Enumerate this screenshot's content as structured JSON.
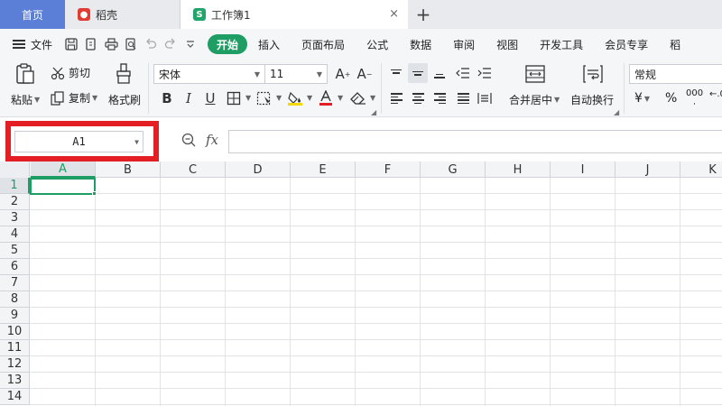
{
  "tabs": {
    "home": "首页",
    "daoke": "稻壳",
    "workbook": "工作簿1",
    "workbook_logo": "S",
    "close_glyph": "×",
    "add_glyph": "+"
  },
  "menu": {
    "file": "文件",
    "tabs": [
      "开始",
      "插入",
      "页面布局",
      "公式",
      "数据",
      "审阅",
      "视图",
      "开发工具",
      "会员专享",
      "稻"
    ],
    "active_tab": "开始"
  },
  "ribbon": {
    "paste": "粘贴",
    "cut": "剪切",
    "copy": "复制",
    "format_painter": "格式刷",
    "font_name": "宋体",
    "font_size": "11",
    "merge_center": "合并居中",
    "wrap_text": "自动换行",
    "number_format": "常规",
    "currency": "¥",
    "percent": "%",
    "thousands": "000"
  },
  "formula_bar": {
    "cell_ref": "A1",
    "fx_label": "fx",
    "formula_value": ""
  },
  "grid": {
    "columns": [
      "A",
      "B",
      "C",
      "D",
      "E",
      "F",
      "G",
      "H",
      "I",
      "J",
      "K"
    ],
    "rows": [
      "1",
      "2",
      "3",
      "4",
      "5",
      "6",
      "7",
      "8",
      "9",
      "10",
      "11",
      "12",
      "13",
      "14"
    ],
    "selected_column": "A",
    "selected_row": "1"
  },
  "colors": {
    "accent_green": "#1e9e64",
    "home_tab_blue": "#5b7fd6",
    "highlight_red": "#e31e24"
  }
}
